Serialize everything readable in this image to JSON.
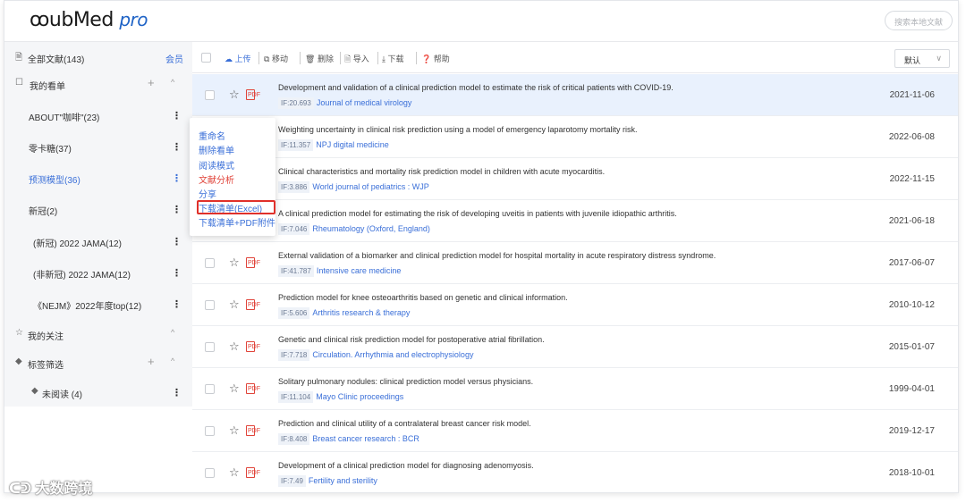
{
  "header": {
    "logo_main": "ubMed",
    "logo_pro": "pro",
    "search_placeholder": "搜索本地文献"
  },
  "sidebar": {
    "all_docs": "全部文献(143)",
    "member": "会员",
    "my_boards": "我的看单",
    "items": [
      {
        "label": "ABOUT\"咖啡\"(23)"
      },
      {
        "label": "零卡糖(37)"
      },
      {
        "label": "预测模型(36)"
      },
      {
        "label": "新冠(2)"
      },
      {
        "label": "(新冠) 2022 JAMA(12)"
      },
      {
        "label": "(非新冠) 2022 JAMA(12)"
      },
      {
        "label": "《NEJM》2022年度top(12)"
      }
    ],
    "my_follow": "我的关注",
    "tag_filter": "标签筛选",
    "unread": "未阅读 (4)"
  },
  "context_menu": {
    "items": [
      {
        "label": "重命名"
      },
      {
        "label": "删除看单"
      },
      {
        "label": "阅读模式"
      },
      {
        "label": "文献分析"
      },
      {
        "label": "分享"
      },
      {
        "label": "下载清单(Excel)"
      },
      {
        "label": "下载清单+PDF附件"
      }
    ]
  },
  "toolbar": {
    "upload": "上传",
    "move": "移动",
    "delete": "删除",
    "import": "导入",
    "download": "下载",
    "help": "帮助",
    "sort_value": "默认"
  },
  "articles": [
    {
      "title": "Development and validation of a clinical prediction model to estimate the risk of critical patients with COVID-19.",
      "if": "IF:20.693",
      "journal": "Journal of medical virology",
      "date": "2021-11-06"
    },
    {
      "title": "Weighting uncertainty in clinical risk prediction using a model of emergency laparotomy mortality risk.",
      "if": "IF:11.357",
      "journal": "NPJ digital medicine",
      "date": "2022-06-08"
    },
    {
      "title": "Clinical characteristics and mortality risk prediction model in children with acute myocarditis.",
      "if": "IF:3.886",
      "journal": "World journal of pediatrics : WJP",
      "date": "2022-11-15"
    },
    {
      "title": "A clinical prediction model for estimating the risk of developing uveitis in patients with juvenile idiopathic arthritis.",
      "if": "IF:7.046",
      "journal": "Rheumatology (Oxford, England)",
      "date": "2021-06-18"
    },
    {
      "title": "External validation of a biomarker and clinical prediction model for hospital mortality in acute respiratory distress syndrome.",
      "if": "IF:41.787",
      "journal": "Intensive care medicine",
      "date": "2017-06-07"
    },
    {
      "title": "Prediction model for knee osteoarthritis based on genetic and clinical information.",
      "if": "IF:5.606",
      "journal": "Arthritis research & therapy",
      "date": "2010-10-12"
    },
    {
      "title": "Genetic and clinical risk prediction model for postoperative atrial fibrillation.",
      "if": "IF:7.718",
      "journal": "Circulation. Arrhythmia and electrophysiology",
      "date": "2015-01-07"
    },
    {
      "title": "Solitary pulmonary nodules: clinical prediction model versus physicians.",
      "if": "IF:11.104",
      "journal": "Mayo Clinic proceedings",
      "date": "1999-04-01"
    },
    {
      "title": "Prediction and clinical utility of a contralateral breast cancer risk model.",
      "if": "IF:8.408",
      "journal": "Breast cancer research : BCR",
      "date": "2019-12-17"
    },
    {
      "title": "Development of a clinical prediction model for diagnosing adenomyosis.",
      "if": "IF:7.49",
      "journal": "Fertility and sterility",
      "date": "2018-10-01"
    }
  ],
  "watermark": "大数跨境"
}
